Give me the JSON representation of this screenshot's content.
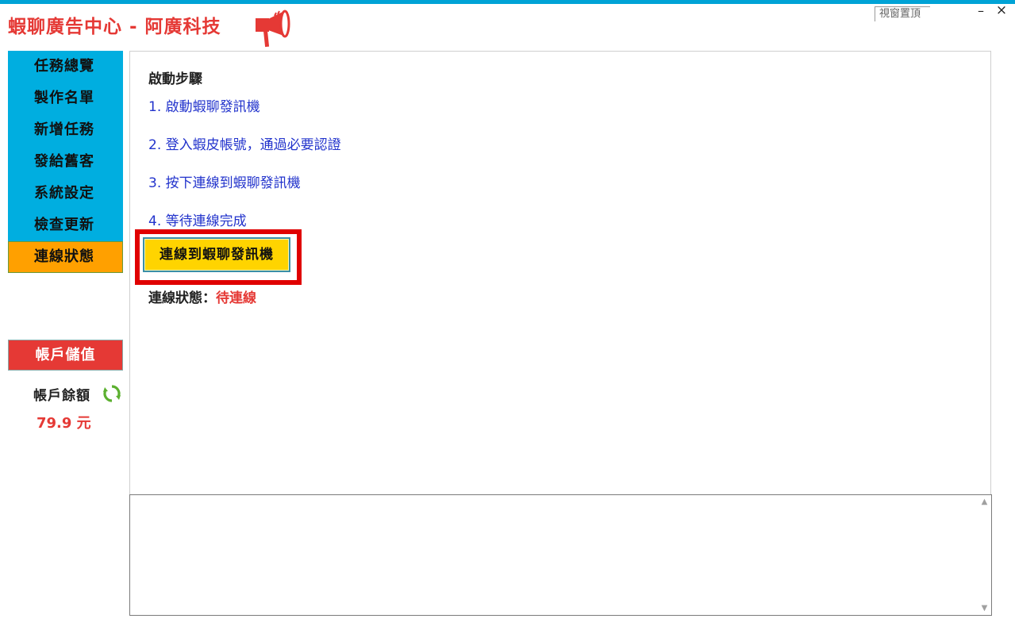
{
  "app": {
    "title": "蝦聊廣告中心 - 阿廣科技",
    "brand_color": "#e53935",
    "accent_color": "#00a3d6",
    "logo_icon": "megaphone-icon"
  },
  "window": {
    "pin_label": "視窗置頂",
    "minimize_label": "–",
    "close_label": "×"
  },
  "sidebar": {
    "items": [
      {
        "label": "任務總覽",
        "active": false
      },
      {
        "label": "製作名單",
        "active": false
      },
      {
        "label": "新增任務",
        "active": false
      },
      {
        "label": "發給舊客",
        "active": false
      },
      {
        "label": "系統設定",
        "active": false
      },
      {
        "label": "檢查更新",
        "active": false
      },
      {
        "label": "連線狀態",
        "active": true
      }
    ],
    "item_color": "#00aee0",
    "active_color": "#ffa000",
    "topup_label": "帳戶儲值",
    "topup_color": "#e53935",
    "balance_label": "帳戶餘額",
    "balance_value": "79.9 元",
    "refresh_icon": "refresh-icon"
  },
  "main": {
    "steps_title": "啟動步驟",
    "steps": [
      "1. 啟動蝦聊發訊機",
      "2. 登入蝦皮帳號，通過必要認證",
      "3. 按下連線到蝦聊發訊機",
      "4. 等待連線完成"
    ],
    "connect_button_label": "連線到蝦聊發訊機",
    "connect_button_color": "#ffd400",
    "highlight_color": "#e00000",
    "status_label": "連線狀態：",
    "status_value": "待連線"
  },
  "log": {
    "scroll_up": "▲",
    "scroll_down": "▼"
  }
}
